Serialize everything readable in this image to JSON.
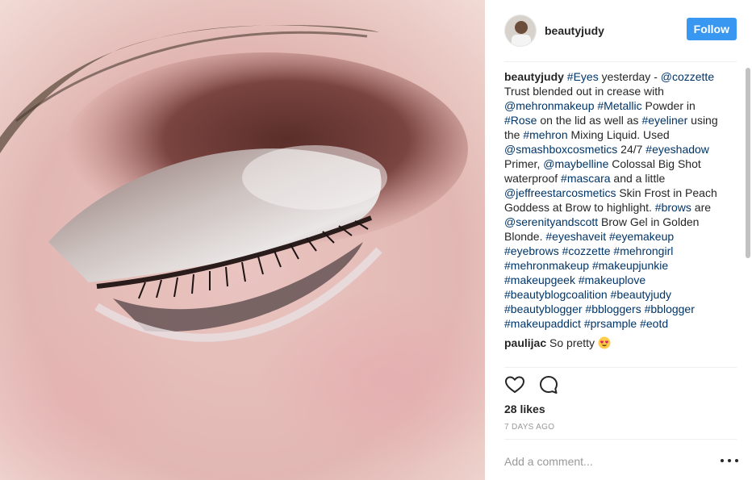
{
  "post": {
    "photo_alt": "",
    "author": "beautyjudy",
    "follow_label": "Follow"
  },
  "caption": {
    "username": "beautyjudy",
    "segments": [
      {
        "text": "#Eyes",
        "type": "tag"
      },
      {
        "text": " yesterday - ",
        "type": "text"
      },
      {
        "text": "@cozzette",
        "type": "tag"
      },
      {
        "text": " Trust blended out in crease with ",
        "type": "text"
      },
      {
        "text": "@mehronmakeup",
        "type": "tag"
      },
      {
        "text": " ",
        "type": "text"
      },
      {
        "text": "#Metallic",
        "type": "tag"
      },
      {
        "text": " Powder in ",
        "type": "text"
      },
      {
        "text": "#Rose",
        "type": "tag"
      },
      {
        "text": " on the lid as well as ",
        "type": "text"
      },
      {
        "text": "#eyeliner",
        "type": "tag"
      },
      {
        "text": " using the ",
        "type": "text"
      },
      {
        "text": "#mehron",
        "type": "tag"
      },
      {
        "text": " Mixing Liquid. Used ",
        "type": "text"
      },
      {
        "text": "@smashboxcosmetics",
        "type": "tag"
      },
      {
        "text": " 24/7 ",
        "type": "text"
      },
      {
        "text": "#eyeshadow",
        "type": "tag"
      },
      {
        "text": " Primer, ",
        "type": "text"
      },
      {
        "text": "@maybelline",
        "type": "tag"
      },
      {
        "text": " Colossal Big Shot waterproof ",
        "type": "text"
      },
      {
        "text": "#mascara",
        "type": "tag"
      },
      {
        "text": " and a little ",
        "type": "text"
      },
      {
        "text": "@jeffreestarcosmetics",
        "type": "tag"
      },
      {
        "text": " Skin Frost in Peach Goddess at Brow to highlight. ",
        "type": "text"
      },
      {
        "text": "#brows",
        "type": "tag"
      },
      {
        "text": " are ",
        "type": "text"
      },
      {
        "text": "@serenityandscott",
        "type": "tag"
      },
      {
        "text": " Brow Gel in Golden Blonde. ",
        "type": "text"
      },
      {
        "text": "#eyeshaveit",
        "type": "tag"
      },
      {
        "text": " ",
        "type": "text"
      },
      {
        "text": "#eyemakeup",
        "type": "tag"
      },
      {
        "text": " ",
        "type": "text"
      },
      {
        "text": "#eyebrows",
        "type": "tag"
      },
      {
        "text": " ",
        "type": "text"
      },
      {
        "text": "#cozzette",
        "type": "tag"
      },
      {
        "text": " ",
        "type": "text"
      },
      {
        "text": "#mehrongirl",
        "type": "tag"
      },
      {
        "text": " ",
        "type": "text"
      },
      {
        "text": "#mehronmakeup",
        "type": "tag"
      },
      {
        "text": " ",
        "type": "text"
      },
      {
        "text": "#makeupjunkie",
        "type": "tag"
      },
      {
        "text": " ",
        "type": "text"
      },
      {
        "text": "#makeupgeek",
        "type": "tag"
      },
      {
        "text": " ",
        "type": "text"
      },
      {
        "text": "#makeuplove",
        "type": "tag"
      },
      {
        "text": " ",
        "type": "text"
      },
      {
        "text": "#beautyblogcoalition",
        "type": "tag"
      },
      {
        "text": " ",
        "type": "text"
      },
      {
        "text": "#beautyjudy",
        "type": "tag"
      },
      {
        "text": " ",
        "type": "text"
      },
      {
        "text": "#beautyblogger",
        "type": "tag"
      },
      {
        "text": " ",
        "type": "text"
      },
      {
        "text": "#bbloggers",
        "type": "tag"
      },
      {
        "text": " ",
        "type": "text"
      },
      {
        "text": "#bblogger",
        "type": "tag"
      },
      {
        "text": " ",
        "type": "text"
      },
      {
        "text": "#makeupaddict",
        "type": "tag"
      },
      {
        "text": " ",
        "type": "text"
      },
      {
        "text": "#prsample",
        "type": "tag"
      },
      {
        "text": " ",
        "type": "text"
      },
      {
        "text": "#eotd",
        "type": "tag"
      }
    ]
  },
  "comments": [
    {
      "username": "paulijac",
      "text": "So pretty",
      "emoji": "heart-eyes"
    }
  ],
  "actions": {
    "like_icon": "heart-outline-icon",
    "comment_icon": "speech-bubble-icon"
  },
  "likes": "28 likes",
  "timestamp": "7 DAYS AGO",
  "add_comment": {
    "placeholder": "Add a comment..."
  },
  "more_icon": "ellipsis-icon",
  "colors": {
    "follow_button": "#3897f0",
    "hashtag": "#003569",
    "divider": "#efefef",
    "muted": "#999999"
  }
}
